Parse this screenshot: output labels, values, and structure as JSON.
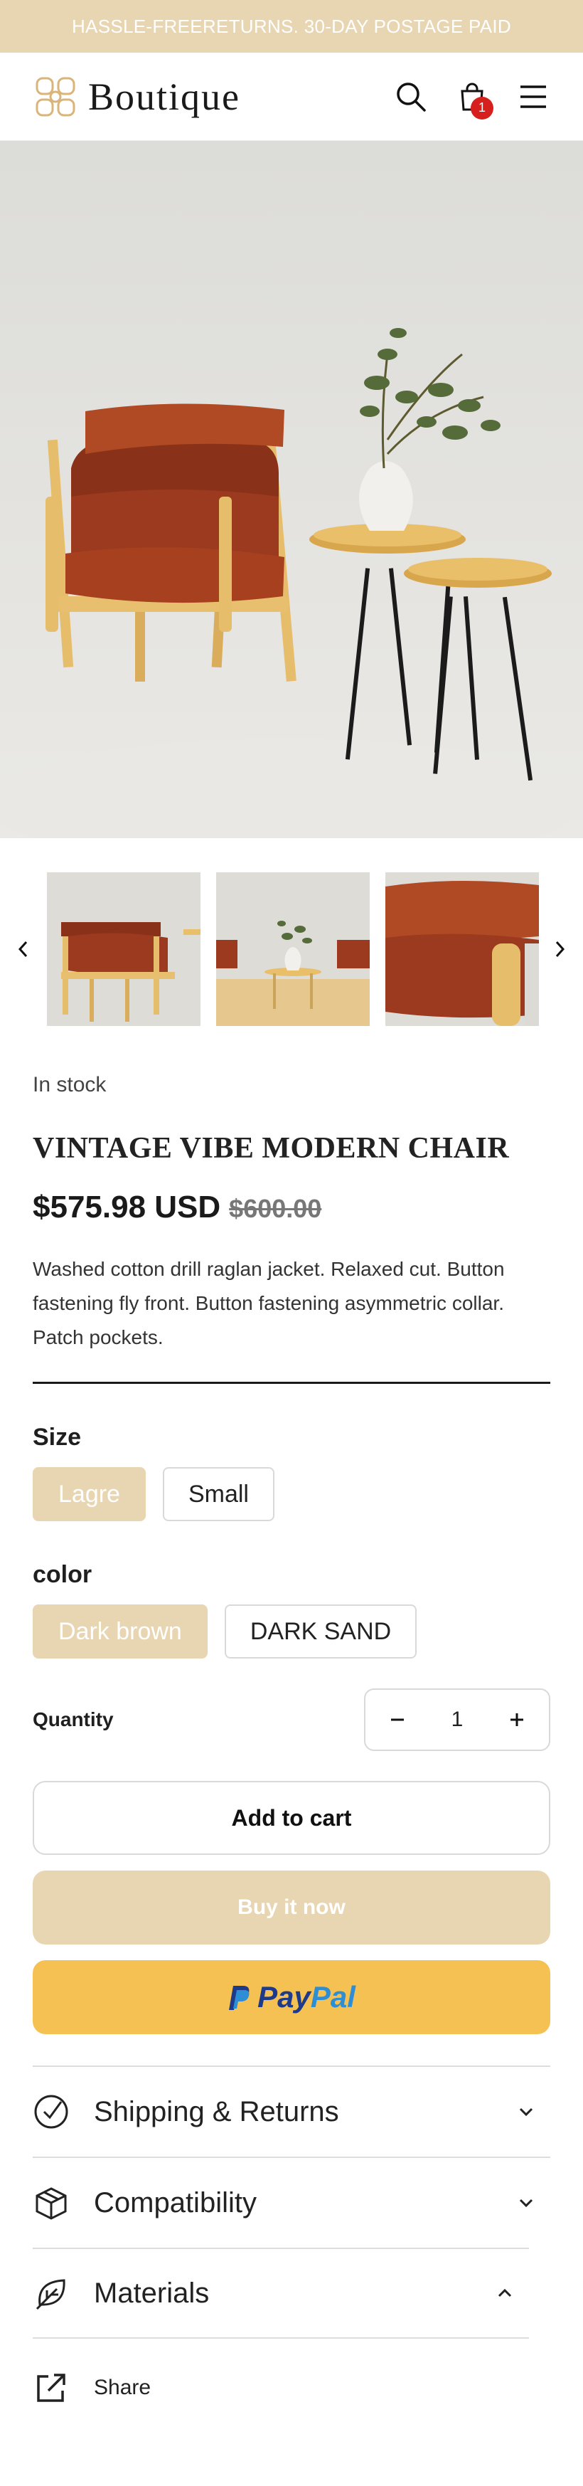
{
  "announcement": "HASSLE-FREERETURNS. 30-DAY POSTAGE PAID",
  "header": {
    "logo_text": "Boutique",
    "cart_count": "1",
    "icons": [
      "search-icon",
      "cart-icon",
      "menu-icon"
    ]
  },
  "product": {
    "stock": "In stock",
    "title": "VINTAGE VIBE MODERN CHAIR",
    "price": "$575.98 USD",
    "compare_price": "$600.00",
    "description": "Washed cotton drill raglan jacket. Relaxed cut. Button fastening fly front. Button fastening asymmetric collar. Patch pockets."
  },
  "options": {
    "size": {
      "label": "Size",
      "values": [
        "Lagre",
        "Small"
      ],
      "selected": "Lagre"
    },
    "color": {
      "label": "color",
      "values": [
        "Dark brown",
        "DARK SAND"
      ],
      "selected": "Dark brown"
    }
  },
  "quantity": {
    "label": "Quantity",
    "value": "1"
  },
  "buttons": {
    "add_to_cart": "Add to cart",
    "buy_now": "Buy it now",
    "paypal_1": "Pay",
    "paypal_2": "Pal"
  },
  "accordion": [
    {
      "label": "Shipping & Returns",
      "icon": "check-circle-icon",
      "expanded": false
    },
    {
      "label": "Compatibility",
      "icon": "box-icon",
      "expanded": false
    },
    {
      "label": "Materials",
      "icon": "leaf-icon",
      "expanded": true
    }
  ],
  "share": {
    "label": "Share"
  },
  "colors": {
    "accent": "#e8d6b3",
    "paypal": "#f5c152",
    "badge": "#d6201e"
  }
}
